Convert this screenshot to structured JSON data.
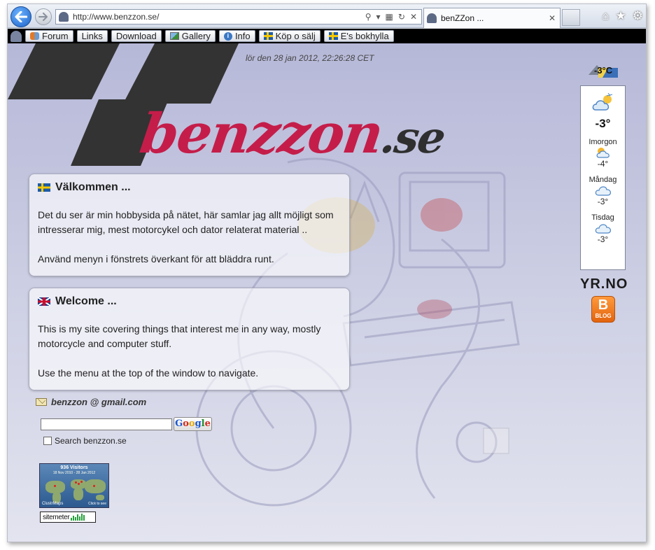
{
  "browser": {
    "address": "http://www.benzzon.se/",
    "tab_title": "benZZon ..."
  },
  "menu": {
    "items": [
      {
        "label": "Forum",
        "icon": "forum-icon"
      },
      {
        "label": "Links",
        "icon": ""
      },
      {
        "label": "Download",
        "icon": ""
      },
      {
        "label": "Gallery",
        "icon": "gallery-icon"
      },
      {
        "label": "Info",
        "icon": "info-icon"
      },
      {
        "label": "Köp o sälj",
        "icon": "swedish-flag-icon"
      },
      {
        "label": "E's bokhylla",
        "icon": "swedish-flag-icon"
      }
    ]
  },
  "page": {
    "datetime": "lör den 28 jan 2012, 22:26:28 CET",
    "logo_main": "benzzon",
    "logo_suffix": ".se"
  },
  "welcome_sv": {
    "title": "Välkommen ...",
    "p1": "Det du ser är min hobbysida på nätet, här samlar jag allt möjligt som intresserar mig, mest motorcykel och dator relaterat material ..",
    "p2": "Använd menyn i fönstrets överkant för att bläddra runt."
  },
  "welcome_en": {
    "title": "Welcome ...",
    "p1": "This is my site covering things that interest me in any way, mostly motorcycle and computer stuff.",
    "p2": "Use the menu at the top of the window to navigate."
  },
  "contact": {
    "email": "benzzon @ gmail.com"
  },
  "search": {
    "value": "",
    "button": [
      "G",
      "o",
      "o",
      "g",
      "l",
      "e"
    ],
    "site_label": "Search benzzon.se"
  },
  "clustermap": {
    "title": "936 Visitors",
    "dates": "18 Nov 2010 - 28 Jan 2012",
    "brand": "ClustrMaps",
    "click": "Click to see"
  },
  "sitemeter": {
    "label": "sitemeter"
  },
  "weather": {
    "badge_temp": "-3°C",
    "now_temp": "-3°",
    "forecast": [
      {
        "day": "Imorgon",
        "temp": "-4°",
        "icon": "sun-cloud-icon"
      },
      {
        "day": "Måndag",
        "temp": "-3°",
        "icon": "cloud-icon"
      },
      {
        "day": "Tisdag",
        "temp": "-3°",
        "icon": "cloud-icon"
      }
    ],
    "provider": "YR.NO"
  },
  "blog": {
    "letter": "B",
    "label": "BLOG"
  },
  "colors": {
    "logo_red": "#c51d4a",
    "checker": "#333333",
    "blog_orange": "#e2640f"
  }
}
